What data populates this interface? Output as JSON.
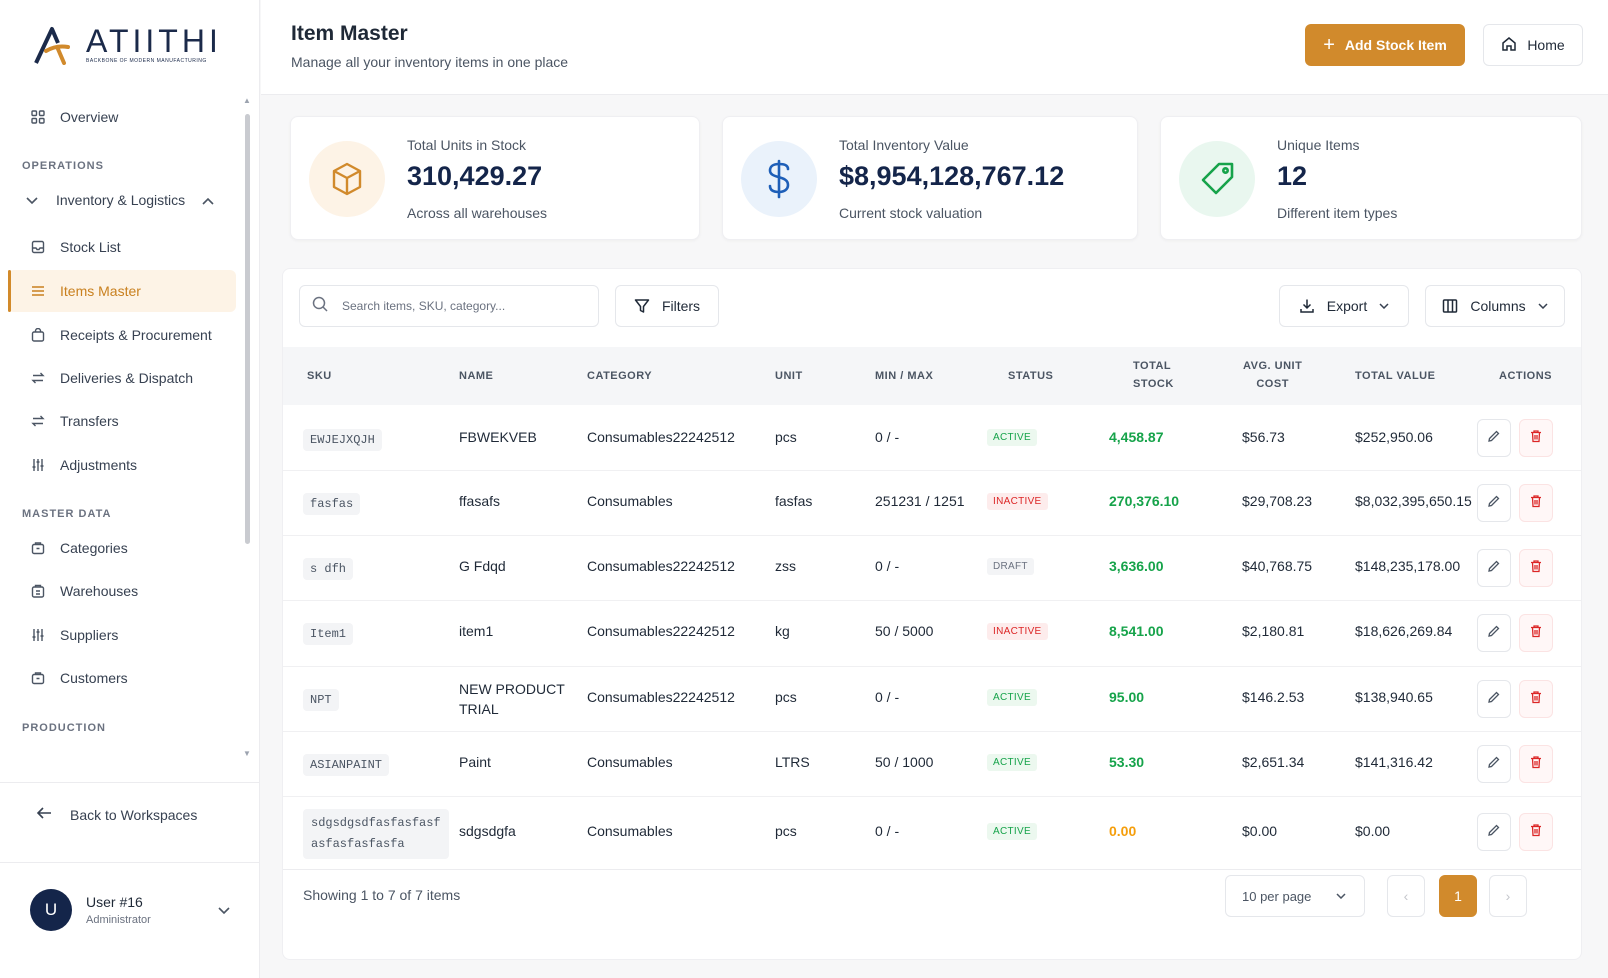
{
  "brand": {
    "name": "ATIITHI",
    "tagline": "BACKBONE OF MODERN MANUFACTURING",
    "primary_color": "#d18a2c",
    "navy": "#14254a"
  },
  "sidebar": {
    "overview": "Overview",
    "sections": {
      "operations": "OPERATIONS",
      "master_data": "MASTER DATA",
      "production": "PRODUCTION"
    },
    "group": "Inventory & Logistics",
    "ops_items": [
      {
        "label": "Stock List",
        "icon": "inbox-icon"
      },
      {
        "label": "Items Master",
        "icon": "list-icon"
      },
      {
        "label": "Receipts & Procurement",
        "icon": "bag-icon"
      },
      {
        "label": "Deliveries & Dispatch",
        "icon": "arrows-icon"
      },
      {
        "label": "Transfers",
        "icon": "arrows-icon"
      },
      {
        "label": "Adjustments",
        "icon": "sliders-icon"
      }
    ],
    "master_items": [
      {
        "label": "Categories",
        "icon": "box-icon"
      },
      {
        "label": "Warehouses",
        "icon": "building-icon"
      },
      {
        "label": "Suppliers",
        "icon": "sliders-icon"
      },
      {
        "label": "Customers",
        "icon": "box-icon"
      }
    ],
    "back": "Back to Workspaces",
    "user": {
      "initial": "U",
      "name": "User #16",
      "role": "Administrator"
    }
  },
  "header": {
    "title": "Item Master",
    "subtitle": "Manage all your inventory items in one place",
    "add_button": "Add Stock Item",
    "home_button": "Home"
  },
  "stats": [
    {
      "label": "Total Units in Stock",
      "value": "310,429.27",
      "sub": "Across all warehouses",
      "icon": "cube-icon"
    },
    {
      "label": "Total Inventory Value",
      "value": "$8,954,128,767.12",
      "sub": "Current stock valuation",
      "icon": "dollar-icon"
    },
    {
      "label": "Unique Items",
      "value": "12",
      "sub": "Different item types",
      "icon": "tag-icon"
    }
  ],
  "toolbar": {
    "search_placeholder": "Search items, SKU, category...",
    "filters": "Filters",
    "export": "Export",
    "columns": "Columns"
  },
  "table": {
    "headers": {
      "sku": "SKU",
      "name": "NAME",
      "category": "CATEGORY",
      "unit": "UNIT",
      "minmax": "MIN / MAX",
      "status": "STATUS",
      "stock_1": "TOTAL",
      "stock_2": "STOCK",
      "cost_1": "AVG. UNIT",
      "cost_2": "COST",
      "value": "TOTAL VALUE",
      "actions": "ACTIONS"
    },
    "rows": [
      {
        "sku": "EWJEJXQJH",
        "name": "FBWEKVEB",
        "category": "Consumables22242512",
        "unit": "pcs",
        "minmax": "0 / -",
        "status": "ACTIVE",
        "stock": "4,458.87",
        "cost": "$56.73",
        "value": "$252,950.06"
      },
      {
        "sku": "fasfas",
        "name": "ffasafs",
        "category": "Consumables",
        "unit": "fasfas",
        "minmax": "251231 / 1251",
        "status": "INACTIVE",
        "stock": "270,376.10",
        "cost": "$29,708.23",
        "value": "$8,032,395,650.15"
      },
      {
        "sku": "s dfh",
        "name": "G Fdqd",
        "category": "Consumables22242512",
        "unit": "zss",
        "minmax": "0 / -",
        "status": "DRAFT",
        "stock": "3,636.00",
        "cost": "$40,768.75",
        "value": "$148,235,178.00"
      },
      {
        "sku": "Item1",
        "name": "item1",
        "category": "Consumables22242512",
        "unit": "kg",
        "minmax": "50 / 5000",
        "status": "INACTIVE",
        "stock": "8,541.00",
        "cost": "$2,180.81",
        "value": "$18,626,269.84"
      },
      {
        "sku": "NPT",
        "name_1": "NEW PRODUCT",
        "name_2": "TRIAL",
        "category": "Consumables22242512",
        "unit": "pcs",
        "minmax": "0 / -",
        "status": "ACTIVE",
        "stock": "95.00",
        "cost": "$146.2.53",
        "value": "$138,940.65"
      },
      {
        "sku": "ASIANPAINT",
        "name": "Paint",
        "category": "Consumables",
        "unit": "LTRS",
        "minmax": "50 / 1000",
        "status": "ACTIVE",
        "stock": "53.30",
        "cost": "$2,651.34",
        "value": "$141,316.42"
      },
      {
        "sku_1": "sdgsdgsdfasfasfasf",
        "sku_2": "asfasfasfasfa",
        "name": "sdgsdgfa",
        "category": "Consumables",
        "unit": "pcs",
        "minmax": "0 / -",
        "status": "ACTIVE",
        "stock": "0.00",
        "cost": "$0.00",
        "value": "$0.00"
      }
    ],
    "stock_colors": {
      "positive": "#16a34a",
      "zero": "#f59e0b"
    }
  },
  "footer": {
    "showing": "Showing 1 to 7 of 7 items",
    "per_page": "10 per page",
    "current_page": "1",
    "prev": "‹",
    "next": "›"
  }
}
